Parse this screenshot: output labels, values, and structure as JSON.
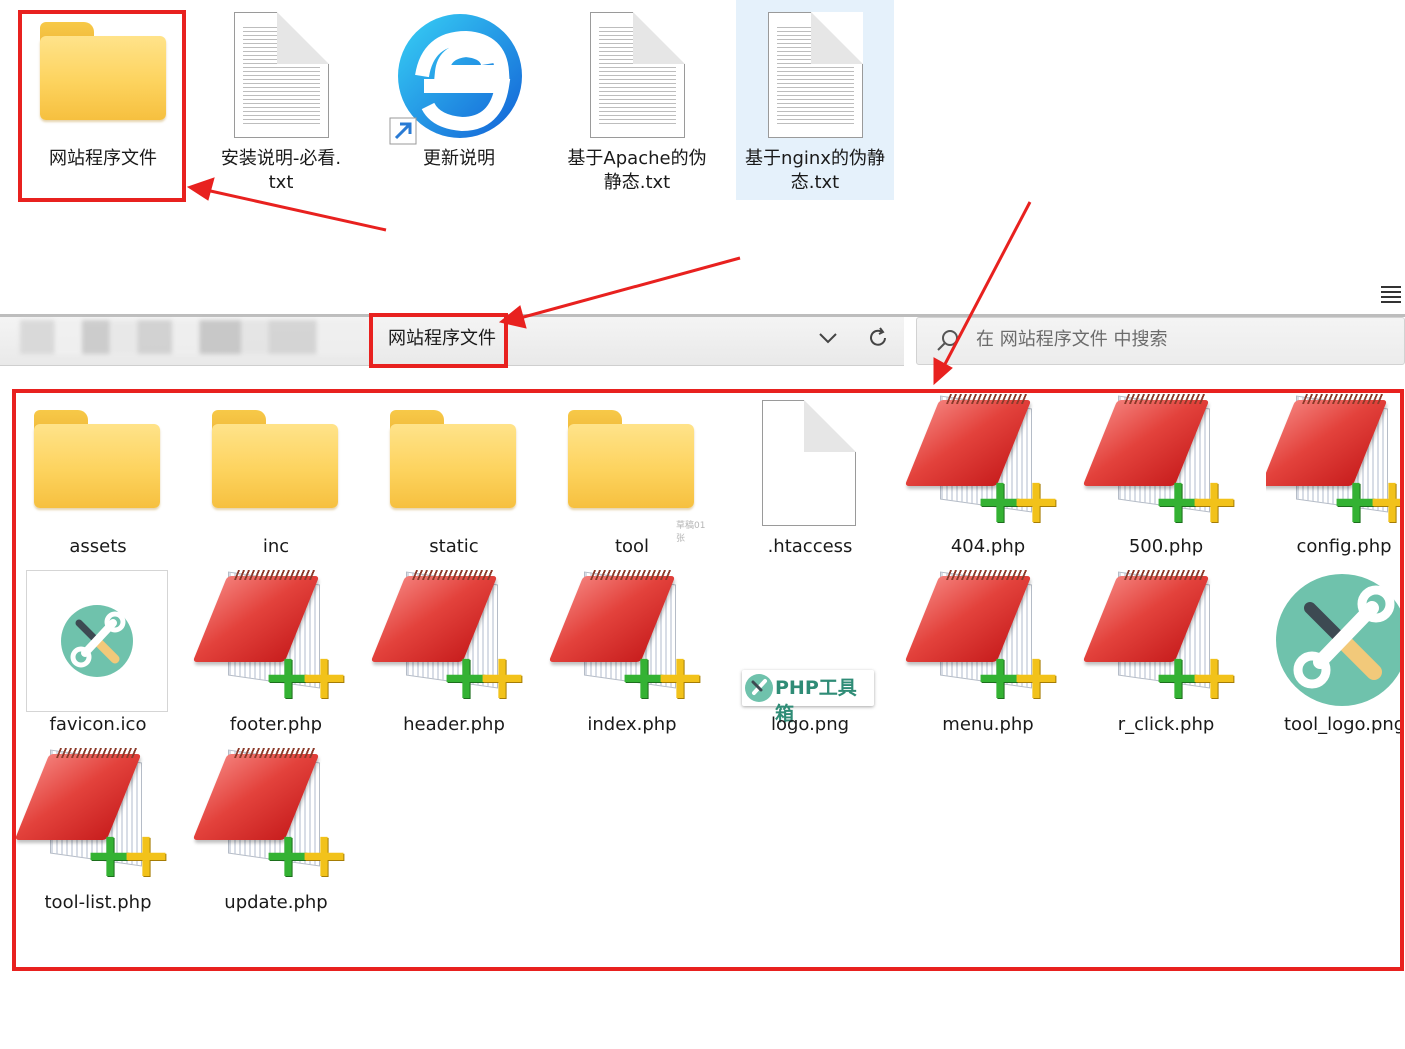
{
  "desktop_items": [
    {
      "label": "网站程序文件",
      "icon": "folder-icon"
    },
    {
      "label": "安装说明-必看.\ntxt",
      "icon": "text-file-icon"
    },
    {
      "label": "更新说明",
      "icon": "browser-shortcut-icon"
    },
    {
      "label": "基于Apache的伪\n静态.txt",
      "icon": "text-file-icon"
    },
    {
      "label": "基于nginx的伪静\n态.txt",
      "icon": "text-file-icon"
    }
  ],
  "address_bar": {
    "current_folder": "网站程序文件",
    "search_placeholder": "在 网站程序文件 中搜索"
  },
  "files": [
    {
      "name": "assets",
      "type": "folder"
    },
    {
      "name": "inc",
      "type": "folder"
    },
    {
      "name": "static",
      "type": "folder"
    },
    {
      "name": "tool",
      "type": "folder"
    },
    {
      "name": ".htaccess",
      "type": "blank-file"
    },
    {
      "name": "404.php",
      "type": "php"
    },
    {
      "name": "500.php",
      "type": "php"
    },
    {
      "name": "config.php",
      "type": "php"
    },
    {
      "name": "favicon.ico",
      "type": "ico"
    },
    {
      "name": "footer.php",
      "type": "php"
    },
    {
      "name": "header.php",
      "type": "php"
    },
    {
      "name": "index.php",
      "type": "php"
    },
    {
      "name": "logo.png",
      "type": "logo"
    },
    {
      "name": "menu.php",
      "type": "php"
    },
    {
      "name": "r_click.php",
      "type": "php"
    },
    {
      "name": "tool_logo.png",
      "type": "wrench"
    },
    {
      "name": "tool-list.php",
      "type": "php"
    },
    {
      "name": "update.php",
      "type": "php"
    }
  ],
  "logo_text": "PHP工具箱",
  "watermark": "草稿01张",
  "colors": {
    "annotation_red": "#e8211f",
    "folder_yellow": "#fdd35e",
    "selection_blue": "#e5f1fb"
  }
}
